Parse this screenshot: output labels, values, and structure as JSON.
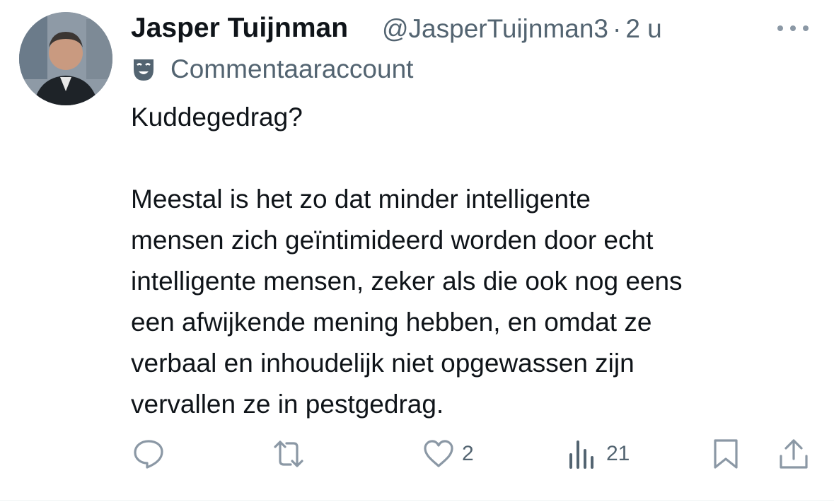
{
  "author": {
    "display_name": "Jasper Tuijnman",
    "handle": "@JasperTuijnman3",
    "separator": "·",
    "time": "2 u"
  },
  "account_label": {
    "text": "Commentaaraccount",
    "icon": "theater-mask-icon"
  },
  "tweet": {
    "line1": "Kuddegedrag?",
    "paragraph": [
      "Meestal is het zo dat minder intelligente",
      "mensen zich geïntimideerd worden door echt",
      "intelligente mensen, zeker als die ook nog eens",
      "een afwijkende mening hebben, en omdat ze",
      "verbaal en inhoudelijk niet opgewassen zijn",
      "vervallen ze in pestgedrag."
    ]
  },
  "actions": {
    "reply": {
      "icon": "reply-icon",
      "count": ""
    },
    "retweet": {
      "icon": "retweet-icon",
      "count": ""
    },
    "like": {
      "icon": "heart-icon",
      "count": "2"
    },
    "views": {
      "icon": "views-icon",
      "count": "21"
    },
    "bookmark": {
      "icon": "bookmark-icon"
    },
    "share": {
      "icon": "share-icon"
    }
  },
  "colors": {
    "text": "#0f1419",
    "secondary": "#536471",
    "action_icons": "#8b98a5"
  }
}
